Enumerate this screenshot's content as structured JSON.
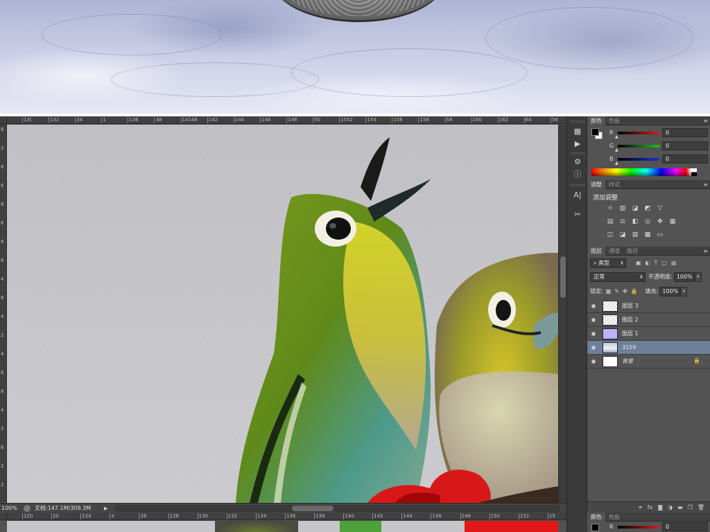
{
  "ruler": {
    "top_ticks": [
      "13(",
      "132",
      "34",
      "1",
      "136",
      "38",
      "14148",
      "142",
      "144",
      "148",
      "148",
      "50",
      "1552",
      "154",
      "156",
      "156",
      "58",
      "160",
      "162",
      "64",
      "56"
    ],
    "left_ticks": [
      "6",
      "2",
      "6",
      "6",
      "8",
      "6",
      "8",
      "6",
      "4",
      "8",
      "4",
      "2",
      "4",
      "6",
      "8",
      "4",
      "2",
      "6",
      "2",
      "2"
    ],
    "bottom_ticks": [
      "120",
      "20",
      "124",
      "4",
      "26",
      "128",
      "130",
      "132",
      "134",
      "136",
      "138",
      "140",
      "142",
      "144",
      "148",
      "148",
      "150",
      "152",
      "15"
    ]
  },
  "status": {
    "zoom": "100%",
    "doc_info": "文档:147.1M/309.3M",
    "arrow": "▶"
  },
  "color_panel": {
    "tabs": [
      "颜色",
      "色板"
    ],
    "rows": [
      {
        "label": "R",
        "value": "0",
        "color": "#d02020"
      },
      {
        "label": "G",
        "value": "0",
        "color": "#20c020"
      },
      {
        "label": "B",
        "value": "0",
        "color": "#2030d0"
      }
    ]
  },
  "adjust_panel": {
    "tabs": [
      "调整",
      "样式"
    ],
    "title": "添加调整"
  },
  "layers_panel": {
    "tabs": [
      "图层",
      "通道",
      "路径"
    ],
    "filter_kind": "类型",
    "blend_mode": "正常",
    "opacity_label": "不透明度:",
    "opacity_value": "100%",
    "lock_label": "锁定:",
    "fill_label": "填充:",
    "fill_value": "100%",
    "layers": [
      {
        "name": "图层 3",
        "thumb": "checker",
        "selected": false,
        "locked": false
      },
      {
        "name": "图层 2",
        "thumb": "checker",
        "selected": false,
        "locked": false
      },
      {
        "name": "图层 1",
        "thumb": "lav",
        "selected": false,
        "locked": false
      },
      {
        "name": "3159",
        "thumb": "marble",
        "selected": true,
        "locked": false
      },
      {
        "name": "背景",
        "thumb": "white",
        "selected": false,
        "locked": true
      }
    ]
  },
  "bottom_panel": {
    "tabs": [
      "颜色",
      "色板"
    ],
    "row_label": "R",
    "row_value": "0"
  }
}
